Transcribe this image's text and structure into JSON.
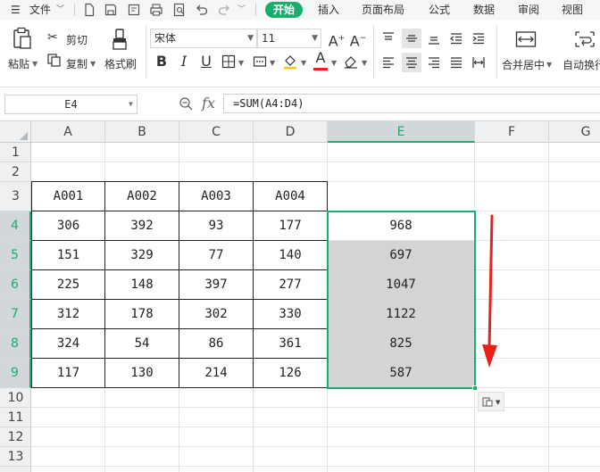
{
  "menu": {
    "file": "文件",
    "tabs": [
      "开始",
      "插入",
      "页面布局",
      "公式",
      "数据",
      "审阅",
      "视图"
    ],
    "active_tab": "开始"
  },
  "ribbon": {
    "paste": "粘贴",
    "cut": "剪切",
    "copy": "复制",
    "format_painter": "格式刷",
    "font_name": "宋体",
    "font_size": "11",
    "merge_center": "合并居中",
    "wrap_text": "自动换行"
  },
  "formula_bar": {
    "name_box": "E4",
    "fx": "fx",
    "formula": "=SUM(A4:D4)"
  },
  "columns": [
    "A",
    "B",
    "C",
    "D",
    "E",
    "F",
    "G"
  ],
  "active_column": "E",
  "rows": [
    "1",
    "2",
    "3",
    "4",
    "5",
    "6",
    "7",
    "8",
    "9",
    "10",
    "11",
    "12",
    "13"
  ],
  "active_rows": [
    "4",
    "5",
    "6",
    "7",
    "8",
    "9"
  ],
  "table": {
    "headers": [
      "A001",
      "A002",
      "A003",
      "A004"
    ],
    "data": [
      [
        "306",
        "392",
        "93",
        "177"
      ],
      [
        "151",
        "329",
        "77",
        "140"
      ],
      [
        "225",
        "148",
        "397",
        "277"
      ],
      [
        "312",
        "178",
        "302",
        "330"
      ],
      [
        "324",
        "54",
        "86",
        "361"
      ],
      [
        "117",
        "130",
        "214",
        "126"
      ]
    ],
    "sums": [
      "968",
      "697",
      "1047",
      "1122",
      "825",
      "587"
    ]
  },
  "colors": {
    "accent": "#1aad6c",
    "annotation": "#e8211b",
    "selection_fill": "#d4d4d4"
  },
  "paste_options_icon": "paste-options-icon"
}
